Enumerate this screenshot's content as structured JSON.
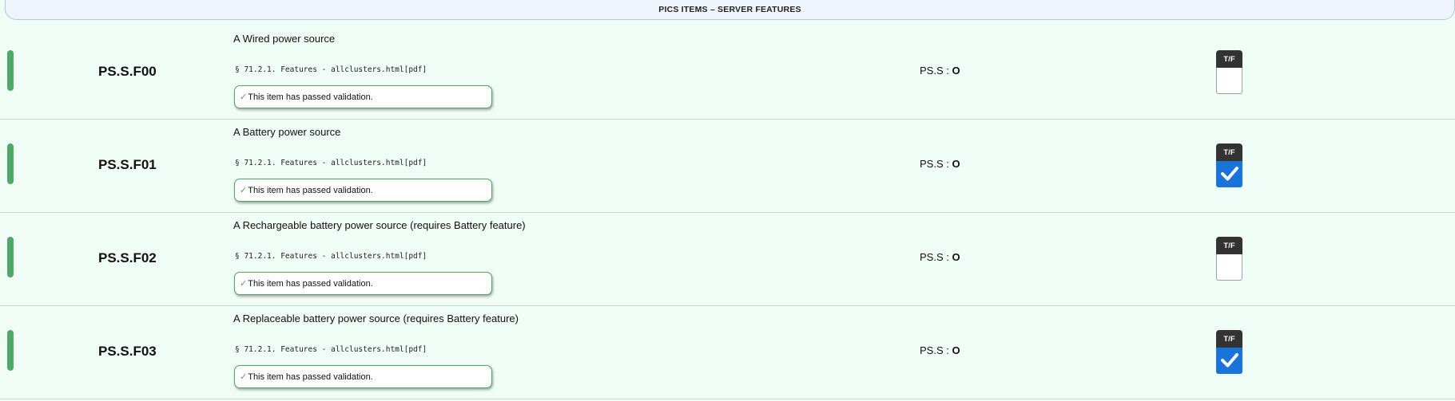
{
  "section": {
    "title": "PICS ITEMS – SERVER FEATURES"
  },
  "rows": [
    {
      "id": "PS.S.F00",
      "description": "A Wired power source",
      "reference": "§ 71.2.1. Features - allclusters.html[pdf]",
      "validation": "This item has passed validation.",
      "conformance_prefix": "PS.S : ",
      "conformance_value": "O",
      "tf_label": "T/F",
      "checked": false
    },
    {
      "id": "PS.S.F01",
      "description": "A Battery power source",
      "reference": "§ 71.2.1. Features - allclusters.html[pdf]",
      "validation": "This item has passed validation.",
      "conformance_prefix": "PS.S : ",
      "conformance_value": "O",
      "tf_label": "T/F",
      "checked": true
    },
    {
      "id": "PS.S.F02",
      "description": "A Rechargeable battery power source (requires Battery feature)",
      "reference": "§ 71.2.1. Features - allclusters.html[pdf]",
      "validation": "This item has passed validation.",
      "conformance_prefix": "PS.S : ",
      "conformance_value": "O",
      "tf_label": "T/F",
      "checked": false
    },
    {
      "id": "PS.S.F03",
      "description": "A Replaceable battery power source (requires Battery feature)",
      "reference": "§ 71.2.1. Features - allclusters.html[pdf]",
      "validation": "This item has passed validation.",
      "conformance_prefix": "PS.S : ",
      "conformance_value": "O",
      "tf_label": "T/F",
      "checked": true
    }
  ],
  "colors": {
    "status_bar": "#4fa865",
    "checkbox_checked": "#1a73d9",
    "row_background": "#f0fcf6"
  },
  "icons": {
    "validation": "check-icon",
    "checkbox": "checkmark-icon"
  }
}
